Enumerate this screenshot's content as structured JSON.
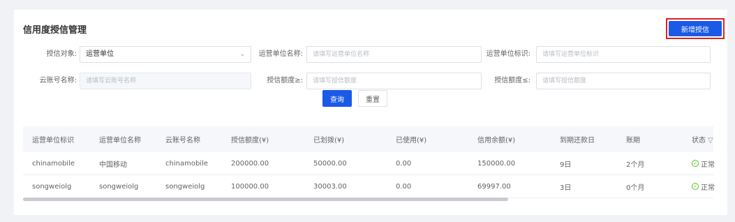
{
  "page": {
    "title": "信用度授信管理",
    "add_button": "新增授信"
  },
  "filters": {
    "credit_target": {
      "label": "授信对象:",
      "value": "运营单位"
    },
    "unit_name": {
      "label": "运营单位名称:",
      "placeholder": "请填写运营单位名称"
    },
    "unit_id": {
      "label": "运营单位标识:",
      "placeholder": "请填写运营单位标识"
    },
    "cloud_account": {
      "label": "云账号名称:",
      "placeholder": "请填写云账号名称"
    },
    "amount_min": {
      "label": "授信额度≥:",
      "placeholder": "请填写授信额度"
    },
    "amount_max": {
      "label": "授信额度≤:",
      "placeholder": "请填写授信额度"
    },
    "query_button": "查询",
    "reset_button": "重置"
  },
  "table": {
    "columns": [
      "运营单位标识",
      "运营单位名称",
      "云账号名称",
      "授信额度(¥)",
      "已划拨(¥)",
      "已使用(¥)",
      "信用余额(¥)",
      "到期还款日",
      "账期",
      "状态"
    ],
    "rows": [
      [
        "chinamobile",
        "中国移动",
        "chinamobile",
        "200000.00",
        "50000.00",
        "0.00",
        "150000.00",
        "9日",
        "2个月",
        "正常"
      ],
      [
        "songweiolg",
        "songweiolg",
        "songweiolg",
        "100000.00",
        "30003.00",
        "0.00",
        "69997.00",
        "3日",
        "0个月",
        "正常"
      ]
    ]
  },
  "colors": {
    "primary": "#1a5ae6",
    "highlight_border": "#e02020",
    "status_ok": "#52c41a"
  }
}
